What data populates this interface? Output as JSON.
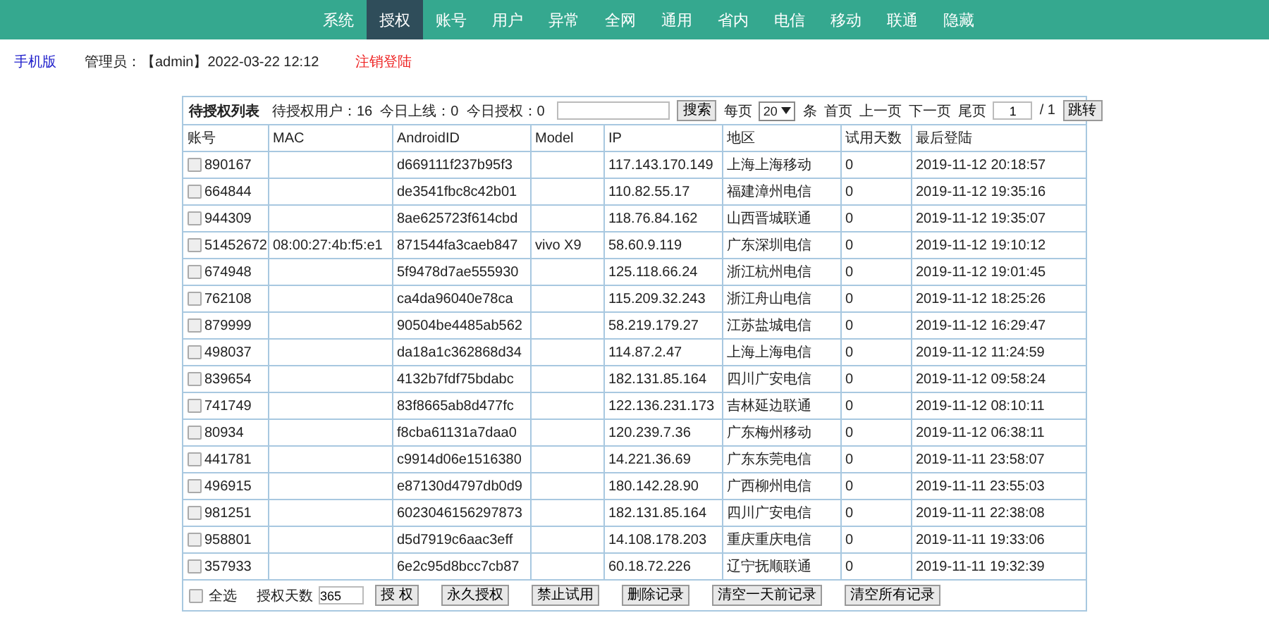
{
  "nav": [
    {
      "label": "系统",
      "selected": false
    },
    {
      "label": "授权",
      "selected": true
    },
    {
      "label": "账号",
      "selected": false
    },
    {
      "label": "用户",
      "selected": false
    },
    {
      "label": "异常",
      "selected": false
    },
    {
      "label": "全网",
      "selected": false
    },
    {
      "label": "通用",
      "selected": false
    },
    {
      "label": "省内",
      "selected": false
    },
    {
      "label": "电信",
      "selected": false
    },
    {
      "label": "移动",
      "selected": false
    },
    {
      "label": "联通",
      "selected": false
    },
    {
      "label": "隐藏",
      "selected": false
    }
  ],
  "info_bar": {
    "mobile_link": "手机版",
    "admin": "管理员：【admin】2022-03-22 12:12",
    "logout": "注销登陆"
  },
  "toolbar": {
    "title": "待授权列表",
    "stats": "待授权用户：16  今日上线：0  今日授权：0",
    "search_button": "搜索",
    "per_page_label": "每页",
    "per_page": "20",
    "per_page_unit": "条",
    "first": "首页",
    "prev": "上一页",
    "next": "下一页",
    "last": "尾页",
    "page": "1",
    "page_total": "/ 1",
    "jump": "跳转"
  },
  "table": {
    "columns": [
      "账号",
      "MAC",
      "AndroidID",
      "Model",
      "IP",
      "地区",
      "试用天数",
      "最后登陆"
    ],
    "rows": [
      {
        "checked": false,
        "cells": [
          "890167",
          "",
          "d669111f237b95f3",
          "",
          "117.143.170.149",
          "上海上海移动",
          "0",
          "2019-11-12 20:18:57"
        ]
      },
      {
        "checked": false,
        "cells": [
          "664844",
          "",
          "de3541fbc8c42b01",
          "",
          "110.82.55.17",
          "福建漳州电信",
          "0",
          "2019-11-12 19:35:16"
        ]
      },
      {
        "checked": false,
        "cells": [
          "944309",
          "",
          "8ae625723f614cbd",
          "",
          "118.76.84.162",
          "山西晋城联通",
          "0",
          "2019-11-12 19:35:07"
        ]
      },
      {
        "checked": false,
        "cells": [
          "51452672",
          "08:00:27:4b:f5:e1",
          "871544fa3caeb847",
          "vivo X9",
          "58.60.9.119",
          "广东深圳电信",
          "0",
          "2019-11-12 19:10:12"
        ]
      },
      {
        "checked": false,
        "cells": [
          "674948",
          "",
          "5f9478d7ae555930",
          "",
          "125.118.66.24",
          "浙江杭州电信",
          "0",
          "2019-11-12 19:01:45"
        ]
      },
      {
        "checked": false,
        "cells": [
          "762108",
          "",
          "ca4da96040e78ca",
          "",
          "115.209.32.243",
          "浙江舟山电信",
          "0",
          "2019-11-12 18:25:26"
        ]
      },
      {
        "checked": false,
        "cells": [
          "879999",
          "",
          "90504be4485ab562",
          "",
          "58.219.179.27",
          "江苏盐城电信",
          "0",
          "2019-11-12 16:29:47"
        ]
      },
      {
        "checked": false,
        "cells": [
          "498037",
          "",
          "da18a1c362868d34",
          "",
          "114.87.2.47",
          "上海上海电信",
          "0",
          "2019-11-12 11:24:59"
        ]
      },
      {
        "checked": false,
        "cells": [
          "839654",
          "",
          "4132b7fdf75bdabc",
          "",
          "182.131.85.164",
          "四川广安电信",
          "0",
          "2019-11-12 09:58:24"
        ]
      },
      {
        "checked": false,
        "cells": [
          "741749",
          "",
          "83f8665ab8d477fc",
          "",
          "122.136.231.173",
          "吉林延边联通",
          "0",
          "2019-11-12 08:10:11"
        ]
      },
      {
        "checked": false,
        "cells": [
          "80934",
          "",
          "f8cba61131a7daa0",
          "",
          "120.239.7.36",
          "广东梅州移动",
          "0",
          "2019-11-12 06:38:11"
        ]
      },
      {
        "checked": false,
        "cells": [
          "441781",
          "",
          "c9914d06e1516380",
          "",
          "14.221.36.69",
          "广东东莞电信",
          "0",
          "2019-11-11 23:58:07"
        ]
      },
      {
        "checked": false,
        "cells": [
          "496915",
          "",
          "e87130d4797db0d9",
          "",
          "180.142.28.90",
          "广西柳州电信",
          "0",
          "2019-11-11 23:55:03"
        ]
      },
      {
        "checked": false,
        "cells": [
          "981251",
          "",
          "6023046156297873",
          "",
          "182.131.85.164",
          "四川广安电信",
          "0",
          "2019-11-11 22:38:08"
        ]
      },
      {
        "checked": false,
        "cells": [
          "958801",
          "",
          "d5d7919c6aac3eff",
          "",
          "14.108.178.203",
          "重庆重庆电信",
          "0",
          "2019-11-11 19:33:06"
        ]
      },
      {
        "checked": false,
        "cells": [
          "357933",
          "",
          "6e2c95d8bcc7cb87",
          "",
          "60.18.72.226",
          "辽宁抚顺联通",
          "0",
          "2019-11-11 19:32:39"
        ]
      }
    ]
  },
  "footer": {
    "select_all": {
      "label": "全选",
      "checked": false
    },
    "days_label": "授权天数",
    "days": "365",
    "buttons": [
      "授 权",
      "永久授权",
      "禁止试用",
      "删除记录",
      "清空一天前记录",
      "清空所有记录"
    ]
  }
}
